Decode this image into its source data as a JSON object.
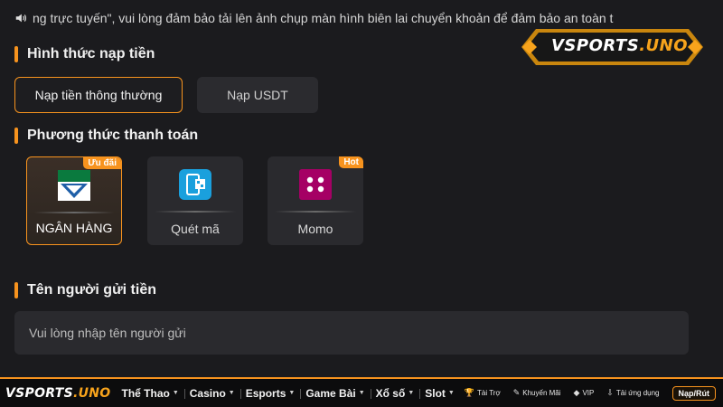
{
  "announcement": {
    "text": "ng trực tuyến\", vui lòng đảm bảo tải lên ảnh chụp màn hình biên lai chuyển khoản để đảm bảo an toàn t",
    "icon": "speaker-icon"
  },
  "brand": {
    "logo_main": "VSPORTS",
    "logo_suffix": ".UNO",
    "accent_color": "#f7931e"
  },
  "deposit_form": {
    "title": "Hình thức nạp tiền",
    "options": [
      {
        "label": "Nạp tiền thông thường",
        "active": true
      },
      {
        "label": "Nạp USDT",
        "active": false
      }
    ]
  },
  "payment_method": {
    "title": "Phương thức thanh toán",
    "methods": [
      {
        "label": "NGÂN HÀNG",
        "badge": "Ưu đãi",
        "icon": "bank-icon",
        "selected": true
      },
      {
        "label": "Quét mã",
        "badge": "",
        "icon": "qr-scan-icon",
        "selected": false
      },
      {
        "label": "Momo",
        "badge": "Hot",
        "icon": "momo-icon",
        "selected": false
      }
    ]
  },
  "sender": {
    "title": "Tên người gửi tiền",
    "placeholder": "Vui lòng nhập tên người gửi"
  },
  "bottom_nav": {
    "items": [
      "Thể Thao",
      "Casino",
      "Esports",
      "Game Bài",
      "Xổ số",
      "Slot"
    ],
    "utilities": [
      {
        "label": "Tài Trợ",
        "icon": "trophy-icon"
      },
      {
        "label": "Khuyến Mãi",
        "icon": "tag-icon"
      },
      {
        "label": "VIP",
        "icon": "diamond-icon"
      },
      {
        "label": "Tải ứng dụng",
        "icon": "download-icon"
      }
    ],
    "action_label": "Nạp/Rút"
  }
}
